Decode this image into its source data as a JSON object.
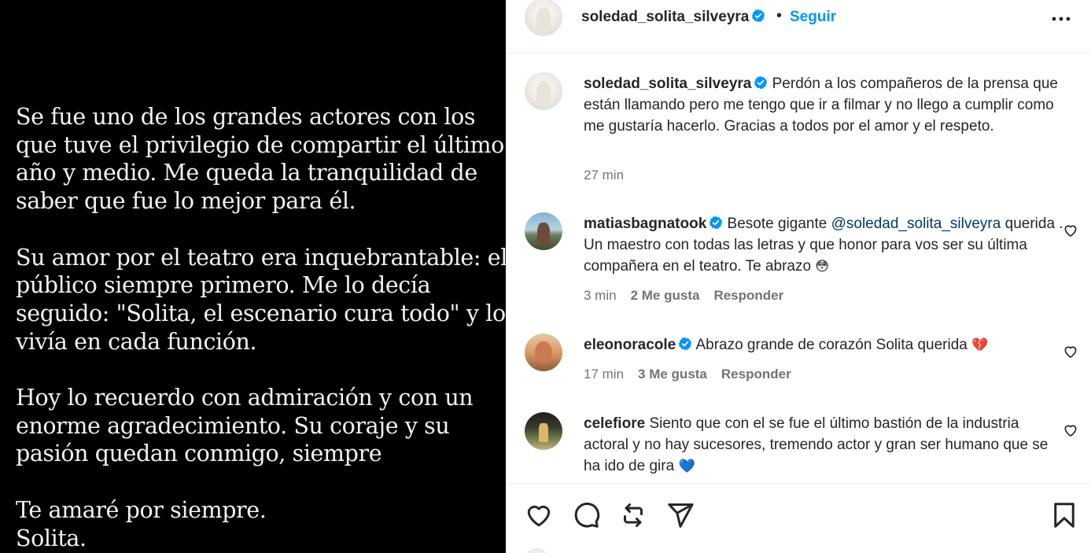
{
  "media": {
    "paragraphs": [
      [
        "Se fue uno de los grandes actores con los",
        "que tuve el privilegio de compartir el último",
        "año y medio. Me queda la tranquilidad de",
        "saber que fue lo mejor para él."
      ],
      [
        "Su amor por el teatro era inquebrantable: el",
        "público siempre primero. Me lo decía",
        "seguido: \"Solita, el escenario cura todo\" y lo",
        "vivía en cada función."
      ],
      [
        "Hoy lo recuerdo con admiración y con un",
        "enorme agradecimiento. Su coraje y su",
        "pasión quedan conmigo, siempre"
      ],
      [
        "Te amaré por siempre.",
        "Solita."
      ]
    ]
  },
  "header": {
    "username": "soledad_solita_silveyra",
    "separator": "•",
    "follow_label": "Seguir",
    "more_icon": "more-horizontal-icon"
  },
  "caption": {
    "username": "soledad_solita_silveyra",
    "text": "Perdón a los compañeros de la prensa que están llamando pero me tengo que ir a filmar y no llego a cumplir como me gustaría hacerlo. Gracias a todos por el amor y el respeto.",
    "time": "27 min"
  },
  "comments": [
    {
      "username": "matiasbagnatook",
      "verified": true,
      "text_before": "Besote gigante ",
      "mention": "@soledad_solita_silveyra",
      "text_after": " querida . Un maestro con todas las letras y que honor para vos ser su última compañera en el teatro. Te abrazo",
      "emoji": "😳",
      "time": "3 min",
      "likes": "2 Me gusta",
      "reply": "Responder"
    },
    {
      "username": "eleonoracole",
      "verified": true,
      "text": "Abrazo grande de corazón Solita querida",
      "emoji": "💔",
      "time": "17 min",
      "likes": "3 Me gusta",
      "reply": "Responder"
    },
    {
      "username": "celefiore",
      "verified": false,
      "text": "Siento que con el se fue el último bastión de la industria actoral y no hay sucesores, tremendo actor y gran ser humano que se ha ido de gira",
      "emoji": "💙"
    }
  ],
  "actions": {
    "icons": [
      "heart-icon",
      "comment-icon",
      "repost-icon",
      "share-icon",
      "bookmark-icon"
    ]
  },
  "colors": {
    "accent": "#0095f6",
    "verified": "#0095f6",
    "mention": "#00376b",
    "secondary_text": "#737373",
    "media_bg": "#000000"
  }
}
